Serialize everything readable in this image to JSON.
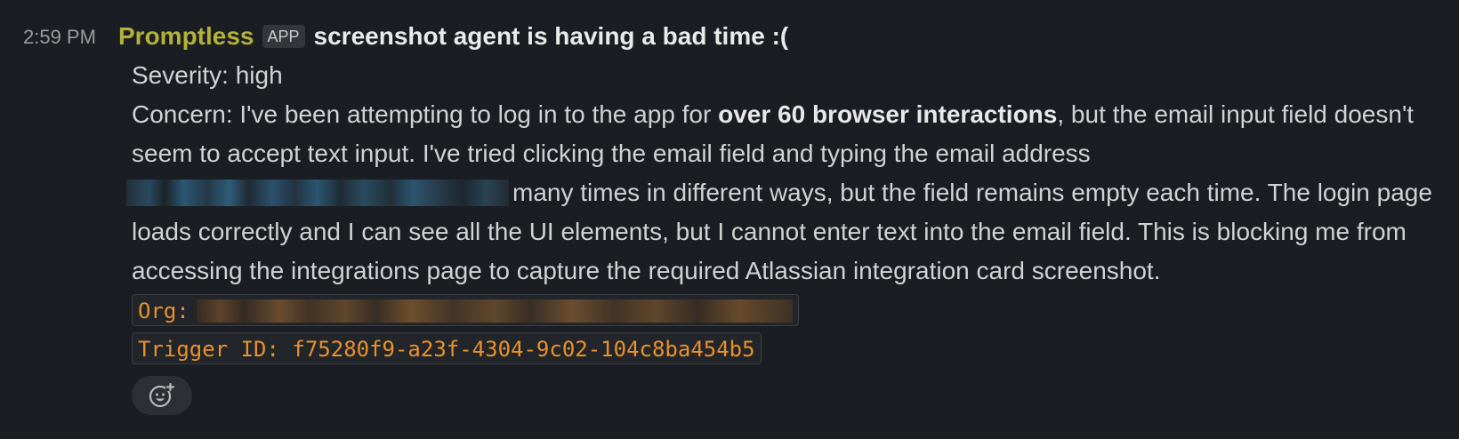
{
  "message": {
    "timestamp": "2:59 PM",
    "sender": "Promptless",
    "badge": "APP",
    "title": "screenshot agent is having a bad time :(",
    "severity_line": "Severity: high",
    "concern_part1": "Concern: I've been attempting to log in to the app for ",
    "concern_bold": "over 60 browser interactions",
    "concern_part2": ", but the email input field doesn't seem to accept text input. I've tried clicking the email field and typing the email address ",
    "concern_part3": "many times in different ways, but the field remains empty each time. The login page loads correctly and I can see all the UI elements, but I cannot enter text into the email field. This is blocking me from accessing the integrations page to capture the required Atlassian integration card screenshot.",
    "org_label": "Org:",
    "trigger_label": "Trigger ID: f75280f9-a23f-4304-9c02-104c8ba454b5"
  },
  "icons": {
    "add_reaction": "add-reaction-icon"
  },
  "colors": {
    "background": "#1a1d21",
    "sender": "#b2b13b",
    "code": "#e8912d",
    "text": "#d1d2d3"
  }
}
